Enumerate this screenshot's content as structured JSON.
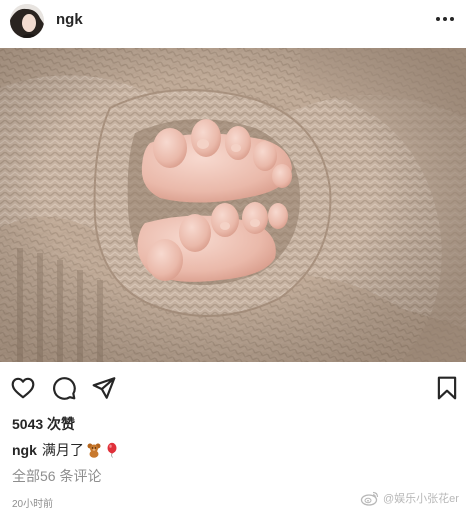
{
  "post": {
    "username": "ngk",
    "likes_text": "5043 次赞",
    "caption_user": "ngk",
    "caption_text": "满月了",
    "caption_emojis": [
      "teddy-bear-icon",
      "balloon-icon"
    ],
    "comments_text": "全部56 条评论",
    "timestamp": "20小时前"
  },
  "watermark": {
    "text": "@娱乐小张花er",
    "icon": "weibo-icon"
  },
  "icons": {
    "more": "more-dots-icon",
    "like": "heart-icon",
    "comment": "comment-bubble-icon",
    "share": "send-icon",
    "save": "bookmark-icon"
  },
  "colors": {
    "text": "#262626",
    "muted": "#8e8e8e",
    "photo_knit": "#c9b8a8"
  }
}
